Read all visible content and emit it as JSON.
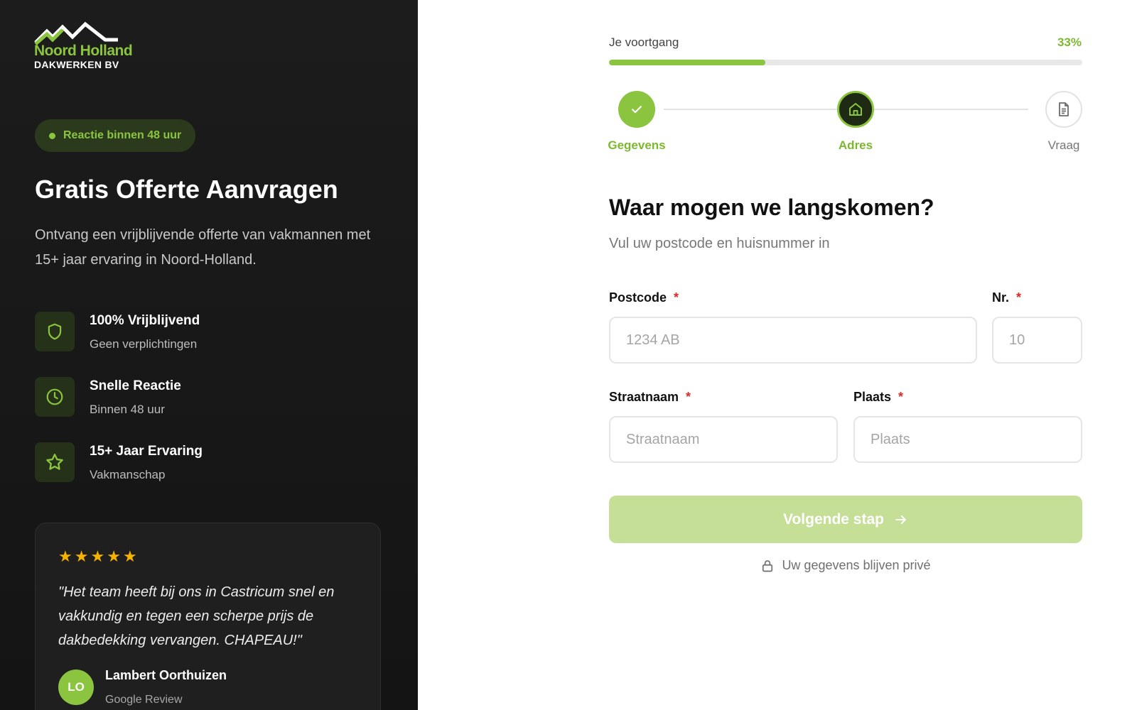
{
  "brand": {
    "name_line1": "Noord Holland",
    "name_line2": "DAKWERKEN BV",
    "accent": "#8bc53f"
  },
  "left": {
    "badge": "Reactie binnen 48 uur",
    "title": "Gratis Offerte Aanvragen",
    "subtitle": "Ontvang een vrijblijvende offerte van vakmannen met 15+ jaar ervaring in Noord-Holland.",
    "features": [
      {
        "icon": "shield-icon",
        "title": "100% Vrijblijvend",
        "desc": "Geen verplichtingen"
      },
      {
        "icon": "clock-icon",
        "title": "Snelle Reactie",
        "desc": "Binnen 48 uur"
      },
      {
        "icon": "star-icon",
        "title": "15+ Jaar Ervaring",
        "desc": "Vakmanschap"
      }
    ],
    "review": {
      "stars": 5,
      "text": "\"Het team heeft bij ons in Castricum snel en vakkundig en tegen een scherpe prijs de dakbedekking vervangen. CHAPEAU!\"",
      "initials": "LO",
      "name": "Lambert Oorthuizen",
      "source": "Google Review"
    }
  },
  "progress": {
    "label": "Je voortgang",
    "percent_text": "33%",
    "percent": 33
  },
  "steps": [
    {
      "label": "Gegevens",
      "state": "done",
      "icon": "check-icon"
    },
    {
      "label": "Adres",
      "state": "active",
      "icon": "home-icon"
    },
    {
      "label": "Vraag",
      "state": "todo",
      "icon": "document-icon"
    }
  ],
  "form": {
    "title": "Waar mogen we langskomen?",
    "subtitle": "Vul uw postcode en huisnummer in",
    "required_mark": "*",
    "fields": {
      "postcode": {
        "label": "Postcode",
        "placeholder": "1234 AB",
        "value": ""
      },
      "number": {
        "label": "Nr.",
        "placeholder": "10",
        "value": ""
      },
      "street": {
        "label": "Straatnaam",
        "placeholder": "Straatnaam",
        "value": ""
      },
      "city": {
        "label": "Plaats",
        "placeholder": "Plaats",
        "value": ""
      }
    },
    "next_label": "Volgende stap",
    "privacy": "Uw gegevens blijven privé"
  }
}
